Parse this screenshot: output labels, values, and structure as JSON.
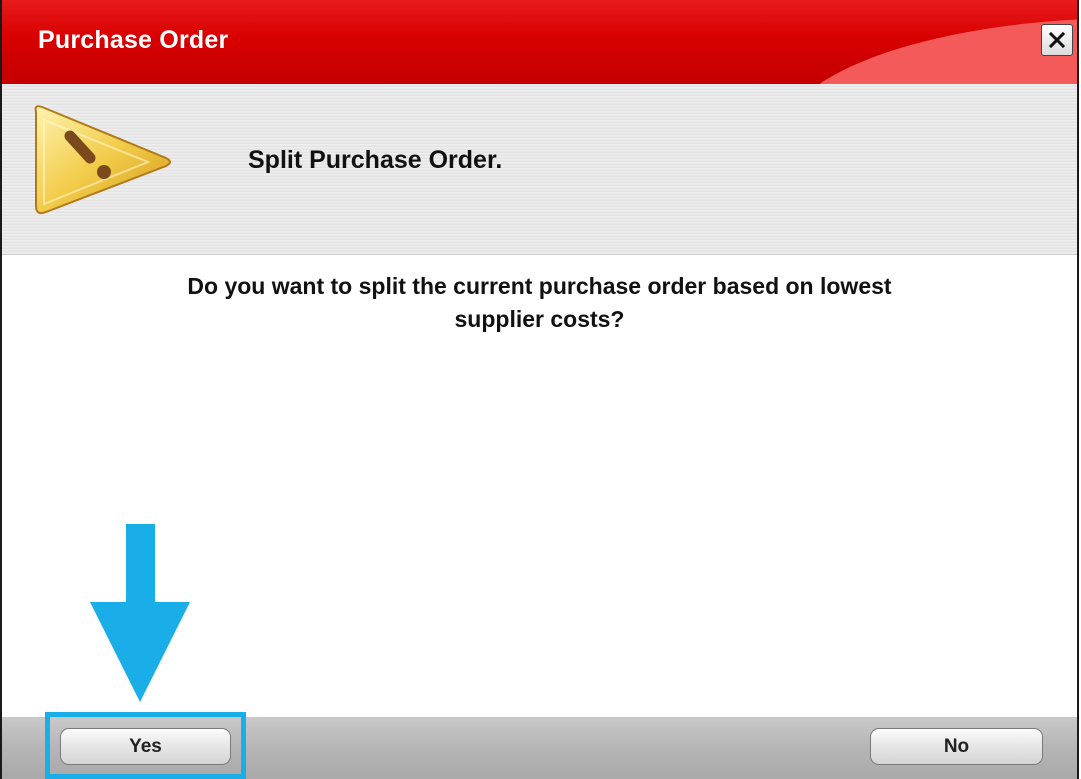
{
  "window": {
    "title": "Purchase Order"
  },
  "header": {
    "icon": "warning-icon",
    "title": "Split Purchase Order."
  },
  "message": {
    "line1": "Do you want to split the current purchase order based on lowest",
    "line2": "supplier costs?"
  },
  "buttons": {
    "yes_label": "Yes",
    "no_label": "No"
  },
  "annotation": {
    "highlight_color": "#1aaee8",
    "arrow_icon": "down-arrow-icon"
  },
  "colors": {
    "titlebar": "#d80000",
    "title_text": "#ffffff"
  }
}
